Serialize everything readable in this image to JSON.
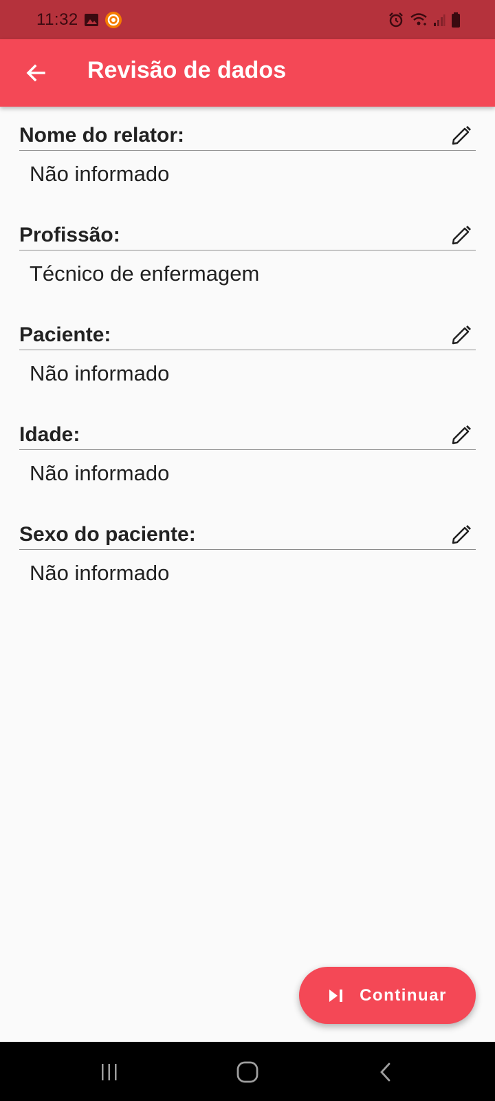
{
  "status_bar": {
    "time": "11:32",
    "left_icons": [
      "image-icon",
      "recorder-icon"
    ],
    "right_icons": [
      "alarm-icon",
      "wifi-icon",
      "signal-icon",
      "battery-icon"
    ]
  },
  "app_bar": {
    "title": "Revisão de dados",
    "back_icon": "arrow-left-icon"
  },
  "fields": [
    {
      "label": "Nome do relator:",
      "value": "Não informado"
    },
    {
      "label": "Profissão:",
      "value": "Técnico de enfermagem"
    },
    {
      "label": "Paciente:",
      "value": "Não informado"
    },
    {
      "label": "Idade:",
      "value": "Não informado"
    },
    {
      "label": "Sexo do paciente:",
      "value": "Não informado"
    }
  ],
  "fab": {
    "label": "Continuar",
    "icon": "skip-next-icon"
  },
  "nav_bar": {
    "icons": [
      "recent-apps-icon",
      "home-icon",
      "back-icon"
    ]
  },
  "colors": {
    "app_bar": "#f44856",
    "status_bar": "#b5323c",
    "background": "#fafafa",
    "nav_bar": "#000000"
  }
}
